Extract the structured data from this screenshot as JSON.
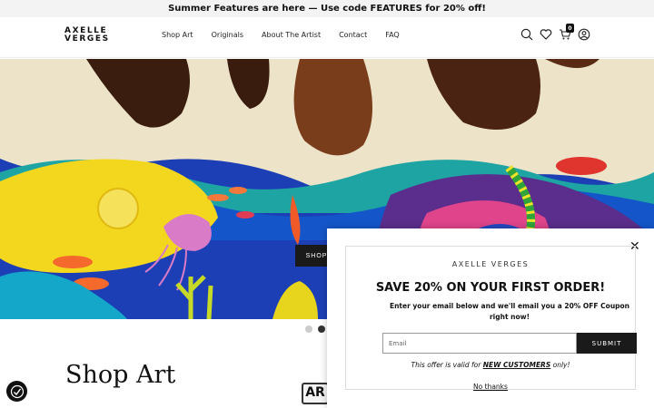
{
  "announcement": {
    "text": "Summer Features are here — Use code FEATURES for 20% off!"
  },
  "header": {
    "logo_line1": "AXELLE",
    "logo_line2": "VERGES",
    "nav": [
      "Shop Art",
      "Originals",
      "About The Artist",
      "Contact",
      "FAQ"
    ],
    "icons": [
      "search-icon",
      "heart-icon",
      "cart-icon",
      "account-icon"
    ],
    "cart_count": "0"
  },
  "hero": {
    "cta_label": "SHOP NOW",
    "slide_count": 2,
    "active_slide": 2
  },
  "section": {
    "title": "Shop Art",
    "badge_text": "AR"
  },
  "popup": {
    "brand": "AXELLE VERGES",
    "title": "SAVE 20% ON YOUR FIRST ORDER!",
    "subtitle": "Enter your email below and we'll email you a 20% OFF Coupon right now!",
    "email_placeholder": "Email",
    "submit_label": "SUBMIT",
    "offer_prefix": "This offer is valid for ",
    "offer_highlight": "NEW CUSTOMERS",
    "offer_suffix": " only!",
    "dismiss_label": "No thanks"
  },
  "colors": {
    "accent": "#1a1a1a",
    "hero_blue": "#1c41b8"
  }
}
